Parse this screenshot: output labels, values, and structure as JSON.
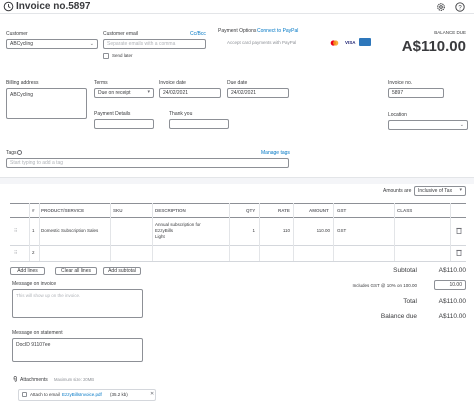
{
  "header": {
    "title": "Invoice no.5897",
    "history_icon": "history-icon",
    "settings_icon": "gear-icon",
    "help_icon": "help-icon"
  },
  "customer": {
    "label": "Customer",
    "value": "ABCycling"
  },
  "customer_email": {
    "label": "Customer email",
    "placeholder": "Separate emails with a comma",
    "cc_bcc": "Cc/Bcc",
    "send_later": "Send later"
  },
  "payment_options": {
    "label": "Payment Options",
    "connect_link": "Connect to PayPal",
    "accept_text": "Accept card payments with PayPal",
    "cards": [
      "mastercard",
      "VISA",
      "amex"
    ]
  },
  "balance": {
    "label": "BALANCE DUE",
    "amount": "A$110.00"
  },
  "billing_address": {
    "label": "Billing address",
    "value": "ABCycling"
  },
  "terms": {
    "label": "Terms",
    "value": "Due on receipt"
  },
  "invoice_date": {
    "label": "Invoice date",
    "value": "24/02/2021"
  },
  "due_date": {
    "label": "Due date",
    "value": "24/02/2021"
  },
  "invoice_no": {
    "label": "Invoice no.",
    "value": "5897"
  },
  "payment_details": {
    "label": "Payment Details"
  },
  "thank_you": {
    "label": "Thank you"
  },
  "location": {
    "label": "Location"
  },
  "tags": {
    "label": "Tags",
    "manage": "Manage tags",
    "placeholder": "Start typing to add a tag"
  },
  "amounts_are": {
    "label": "Amounts are",
    "value": "Inclusive of Tax"
  },
  "table": {
    "headers": {
      "num": "#",
      "product": "PRODUCT/SERVICE",
      "sku": "SKU",
      "description": "DESCRIPTION",
      "qty": "QTY",
      "rate": "RATE",
      "amount": "AMOUNT",
      "gst": "GST",
      "class": "CLASS"
    },
    "rows": [
      {
        "num": "1",
        "product": "Domestic Subscription Sales",
        "sku": "",
        "description_1": "Annual subscription for",
        "description_2": "EzzyBills",
        "description_3": "Light",
        "qty": "1",
        "rate": "110",
        "amount": "110.00",
        "gst": "GST",
        "class": ""
      },
      {
        "num": "2",
        "product": "",
        "sku": "",
        "description_1": "",
        "description_2": "",
        "description_3": "",
        "qty": "",
        "rate": "",
        "amount": "",
        "gst": "",
        "class": ""
      }
    ]
  },
  "line_buttons": {
    "add_lines": "Add lines",
    "clear_all": "Clear all lines",
    "add_subtotal": "Add subtotal"
  },
  "totals": {
    "subtotal_label": "Subtotal",
    "subtotal_value": "A$110.00",
    "gst_label": "Includes GST @ 10% on 100.00",
    "gst_value": "10.00",
    "total_label": "Total",
    "total_value": "A$110.00",
    "balance_label": "Balance due",
    "balance_value": "A$110.00"
  },
  "message_invoice": {
    "label": "Message on invoice",
    "placeholder": "This will show up on the invoice."
  },
  "message_statement": {
    "label": "Message on statement",
    "value": "DocID 91107ee"
  },
  "attachments": {
    "label": "Attachments",
    "max_size": "Maximum size: 20MB",
    "attach_label": "Attach to email",
    "file_name": "EzzyBillsInvoice.pdf",
    "file_size": "(35.2 kb)"
  }
}
